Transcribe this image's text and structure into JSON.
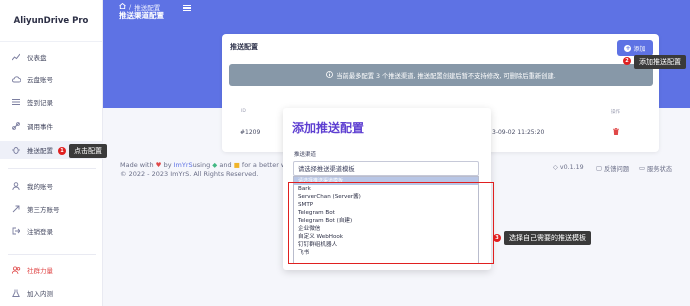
{
  "sidebar": {
    "brand": "AliyunDrive Pro",
    "items": [
      {
        "label": "仪表盘",
        "icon": "chart-line-icon"
      },
      {
        "label": "云盘账号",
        "icon": "cloud-icon"
      },
      {
        "label": "签到记录",
        "icon": "list-icon"
      },
      {
        "label": "调用事件",
        "icon": "link-icon"
      },
      {
        "label": "推送配置",
        "icon": "bug-icon"
      },
      {
        "label": "我的账号",
        "icon": "user-icon"
      },
      {
        "label": "第三方账号",
        "icon": "share-icon"
      },
      {
        "label": "注销登录",
        "icon": "logout-icon"
      },
      {
        "label": "社群力量",
        "icon": "users-icon"
      },
      {
        "label": "加入内测",
        "icon": "flask-icon"
      }
    ]
  },
  "header": {
    "breadcrumb": "推送配置",
    "title": "推送渠道配置"
  },
  "card": {
    "title": "推送配置",
    "add_label": "添加",
    "alert": "当前最多配置 3 个推送渠道, 推送配置创建后暂不支持修改, 可删除后重新创建.",
    "columns": [
      "ID",
      "操作"
    ],
    "row": {
      "id": "#1209",
      "time": "3-09-02 11:25:20"
    }
  },
  "footer": {
    "made_with_a": "Made with",
    "made_with_b": "by",
    "author": "ImYrS",
    "using": "using",
    "and": "and",
    "for_web": "for a better web.",
    "copyright": "© 2022 - 2023 ImYrS. All Rights Reserved.",
    "version": "v0.1.19",
    "feedback": "反馈问题",
    "status": "服务状态"
  },
  "modal": {
    "title": "添加推送配置",
    "label": "推送渠道",
    "select_value": "请选择推送渠道模板",
    "options_first": "请选择推送渠道模板",
    "options": [
      "Bark",
      "ServerChan (Server酱)",
      "SMTP",
      "Telegram Bot",
      "Telegram Bot (自建)",
      "企业微信",
      "自定义 WebHook",
      "钉钉群组机器人",
      "飞书"
    ]
  },
  "annotations": {
    "tip1": "点击配置",
    "tip2": "添加推送配置",
    "tip3": "选择自己需要的推送模板",
    "n1": "1",
    "n2": "2",
    "n3": "3"
  },
  "colors": {
    "header_bg": "#5e72e4",
    "alert_bg": "#8798a8",
    "annotation_red": "#e02020",
    "modal_title": "#5e3fd1"
  }
}
